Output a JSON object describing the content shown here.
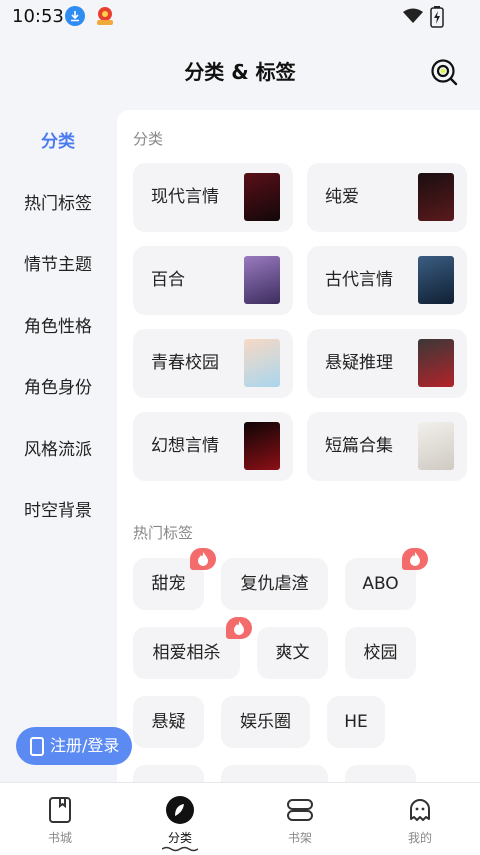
{
  "status": {
    "time": "10:53"
  },
  "header": {
    "title": "分类 & 标签"
  },
  "sidebar": {
    "items": [
      {
        "label": "分类",
        "active": true
      },
      {
        "label": "热门标签"
      },
      {
        "label": "情节主题"
      },
      {
        "label": "角色性格"
      },
      {
        "label": "角色身份"
      },
      {
        "label": "风格流派"
      },
      {
        "label": "时空背景"
      }
    ]
  },
  "categories": {
    "heading": "分类",
    "items": [
      {
        "label": "现代言情",
        "cover": "#3a0f14"
      },
      {
        "label": "纯爱",
        "cover": "#2a1416"
      },
      {
        "label": "百合",
        "cover": "#6b4a8a"
      },
      {
        "label": "古代言情",
        "cover": "#1f3a55"
      },
      {
        "label": "青春校园",
        "cover": "#f5c6b8"
      },
      {
        "label": "悬疑推理",
        "cover": "#2b2a2a"
      },
      {
        "label": "幻想言情",
        "cover": "#1a0a0c"
      },
      {
        "label": "短篇合集",
        "cover": "#e7e5e0"
      }
    ]
  },
  "hot_tags": {
    "heading": "热门标签",
    "items": [
      {
        "label": "甜宠",
        "hot": true
      },
      {
        "label": "复仇虐渣",
        "hot": false
      },
      {
        "label": "ABO",
        "hot": true
      },
      {
        "label": "相爱相杀",
        "hot": true
      },
      {
        "label": "爽文",
        "hot": false
      },
      {
        "label": "校园",
        "hot": false
      },
      {
        "label": "悬疑",
        "hot": false
      },
      {
        "label": "娱乐圈",
        "hot": false
      },
      {
        "label": "HE",
        "hot": false
      }
    ]
  },
  "register_button": {
    "label": "注册/登录"
  },
  "bottom_nav": {
    "items": [
      {
        "label": "书城",
        "icon": "bookstore-icon"
      },
      {
        "label": "分类",
        "icon": "category-icon",
        "active": true
      },
      {
        "label": "书架",
        "icon": "bookshelf-icon"
      },
      {
        "label": "我的",
        "icon": "profile-icon"
      }
    ]
  },
  "colors": {
    "accent": "#4a7cf0",
    "hot": "#f36b6b",
    "register": "#5a8af2"
  }
}
